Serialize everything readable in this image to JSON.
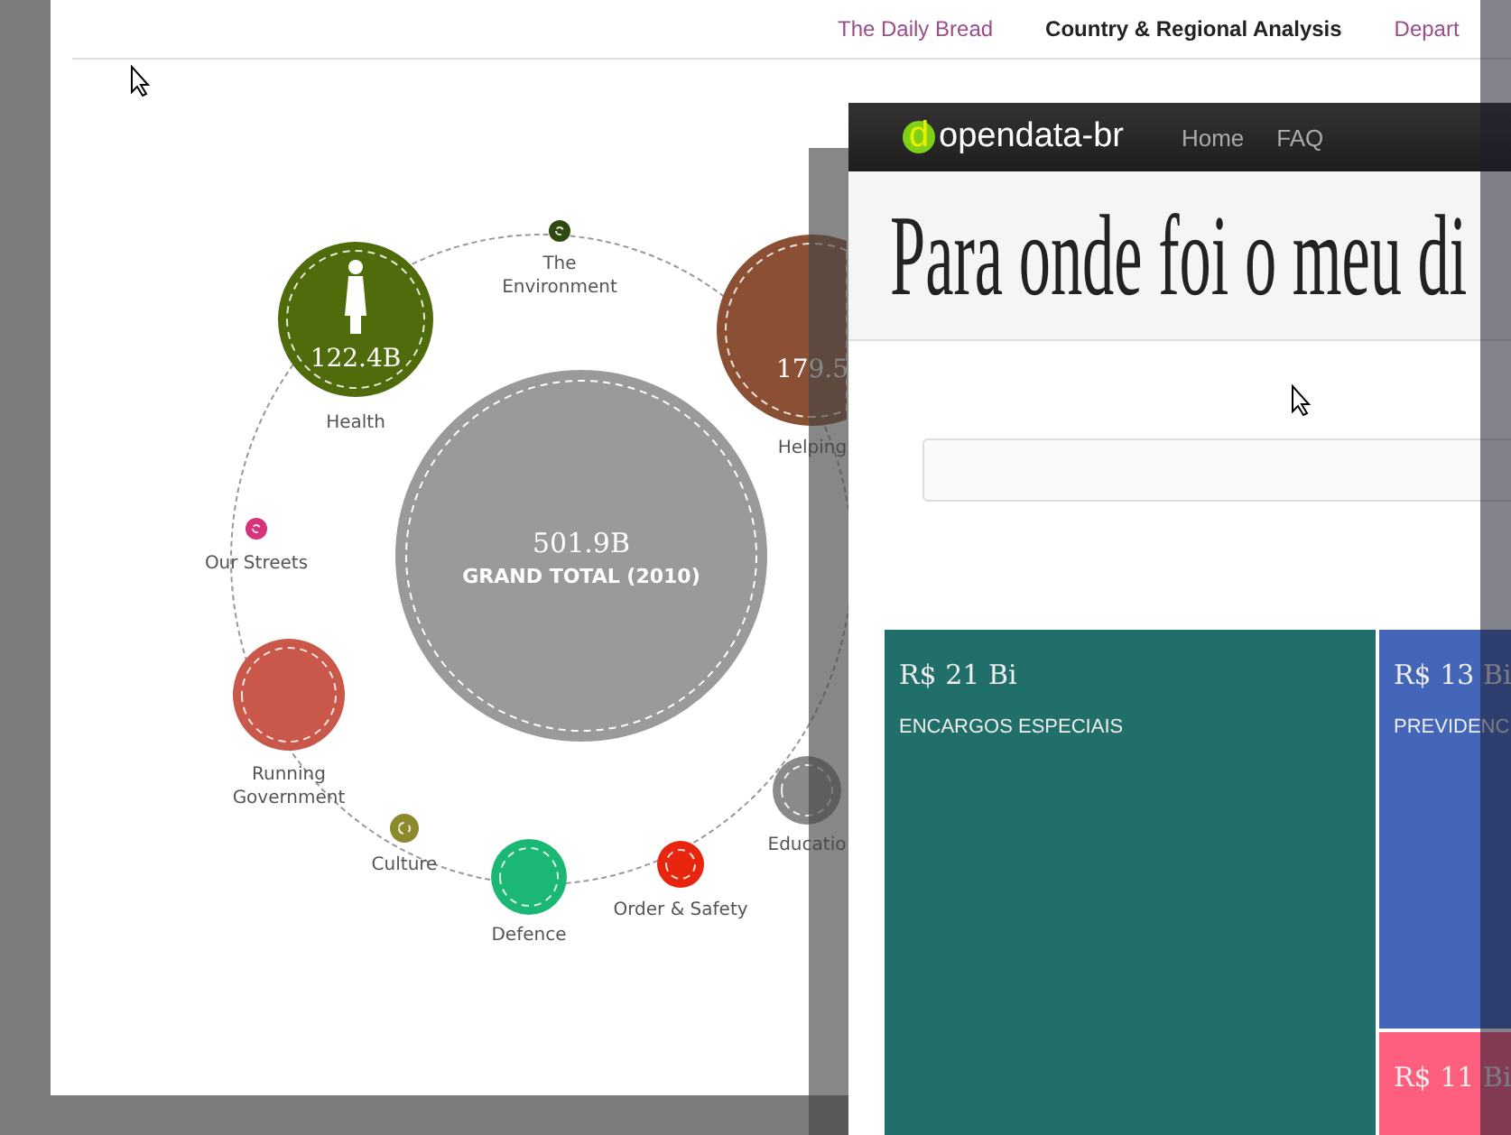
{
  "back_page": {
    "nav": [
      {
        "label": "The Daily Bread",
        "selected": false
      },
      {
        "label": "Country & Regional Analysis",
        "selected": true
      },
      {
        "label": "Depart",
        "selected": false
      }
    ],
    "total": {
      "value": "501.9B",
      "label": "GRAND TOTAL (2010)"
    },
    "bubbles": [
      {
        "label": "Health",
        "value": "122.4B",
        "color": "#4f6b0b",
        "kind": "figure"
      },
      {
        "label": "The\nEnvironment",
        "color": "#2f4a10",
        "kind": "plain"
      },
      {
        "label": "Helping",
        "value": "179.5",
        "color": "#8b4f33",
        "kind": "plain"
      },
      {
        "label": "Our Streets",
        "color": "#d6337a",
        "kind": "plain"
      },
      {
        "label": "Running\nGovernment",
        "color": "#c9574a",
        "kind": "plain"
      },
      {
        "label": "Culture",
        "color": "#8c8a2c",
        "kind": "plain"
      },
      {
        "label": "Defence",
        "color": "#1ab874",
        "kind": "plain"
      },
      {
        "label": "Order & Safety",
        "color": "#e8260f",
        "kind": "plain"
      },
      {
        "label": "Educatio",
        "color": "#8a8a8a",
        "kind": "plain"
      }
    ]
  },
  "front_window": {
    "brand": {
      "mark": "d",
      "name": "opendata-br"
    },
    "nav": [
      "Home",
      "FAQ"
    ],
    "title": "Para onde foi o meu di",
    "treemap": [
      {
        "value": "R$ 21 Bi",
        "label": "ENCARGOS ESPECIAIS",
        "color": "#216f6b"
      },
      {
        "value": "R$ 13 Bi",
        "label": "PREVIDENC",
        "color": "#4466b8"
      },
      {
        "value": "R$ 11 Bi",
        "color": "#ff5f7e"
      }
    ]
  }
}
